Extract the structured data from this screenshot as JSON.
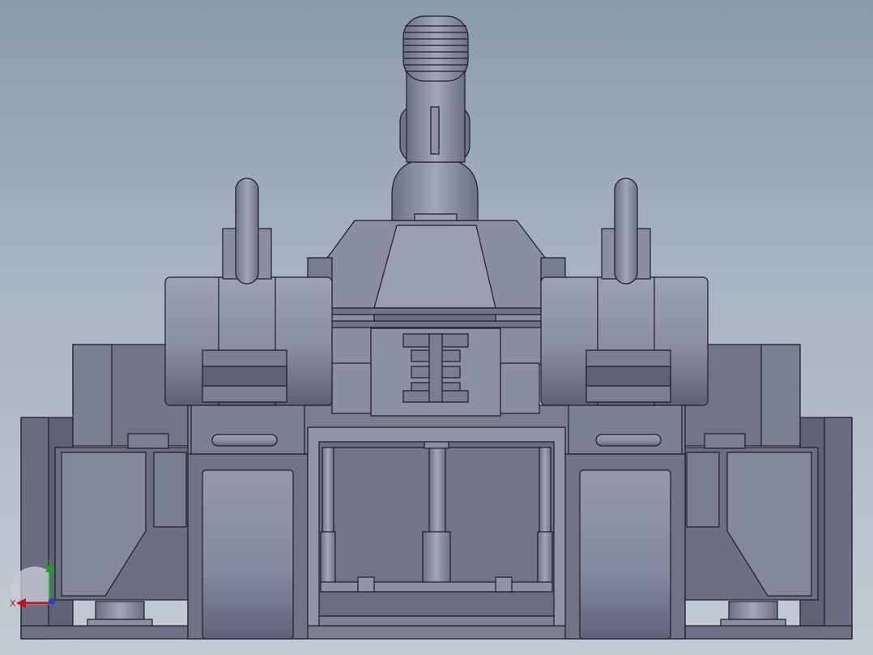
{
  "viewport": {
    "background_top": "#8b9aac",
    "background_bottom": "#c3cbd4"
  },
  "model": {
    "body_color": "#80849a",
    "body_light": "#9a9eb2",
    "body_dark": "#5f6275",
    "line_color": "#1c1d24",
    "emblem_icon": "emblem-icon"
  },
  "triad": {
    "x_label": "X",
    "y_label": "Y",
    "x_color": "#c0141c",
    "y_color": "#1e9e2a",
    "z_color": "#2a3fd0"
  }
}
